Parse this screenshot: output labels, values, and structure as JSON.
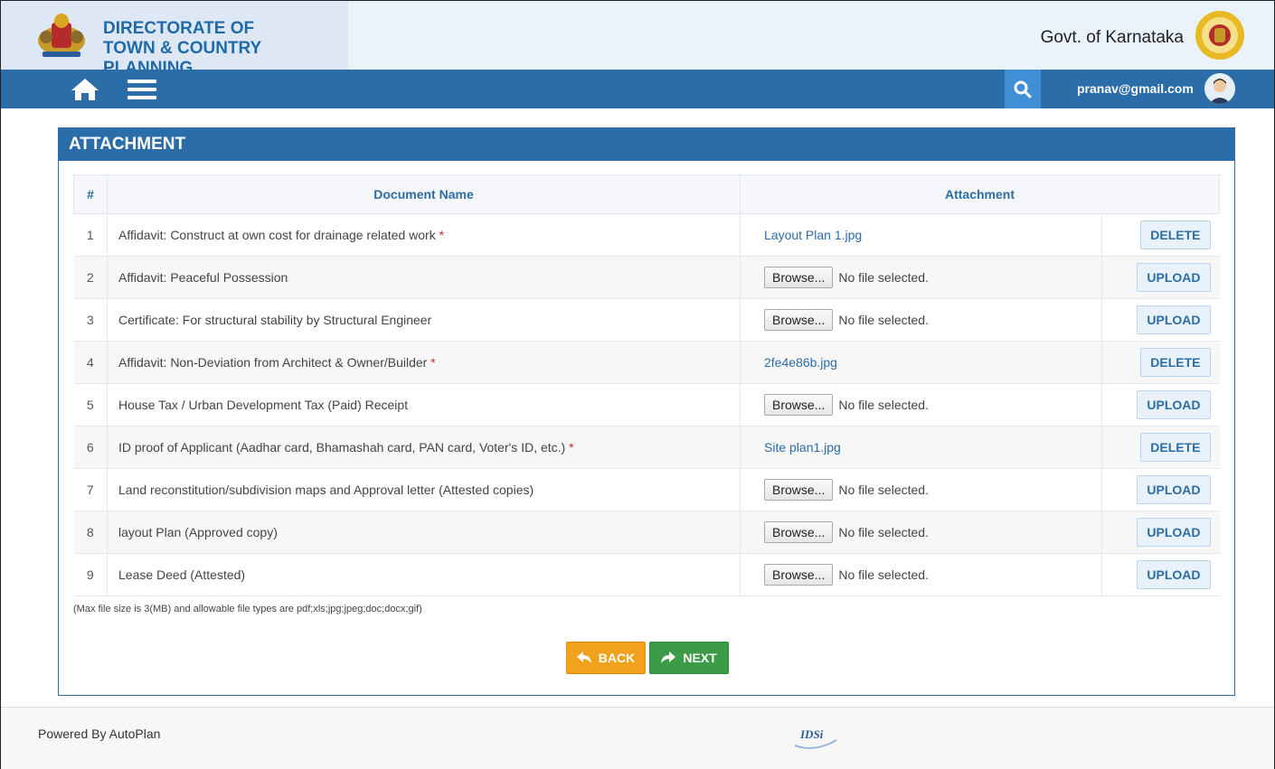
{
  "header": {
    "org_line1": "DIRECTORATE OF",
    "org_line2": "TOWN & COUNTRY PLANNING",
    "govt": "Govt. of Karnataka"
  },
  "navbar": {
    "user_email": "pranav@gmail.com"
  },
  "panel": {
    "title": "ATTACHMENT",
    "columns": [
      "#",
      "Document Name",
      "Attachment"
    ],
    "rows": [
      {
        "num": "1",
        "doc": "Affidavit: Construct at own cost for drainage related work",
        "required": true,
        "file": "Layout Plan 1.jpg",
        "action": "DELETE"
      },
      {
        "num": "2",
        "doc": "Affidavit: Peaceful Possession",
        "required": false,
        "file": null,
        "action": "UPLOAD"
      },
      {
        "num": "3",
        "doc": "Certificate: For structural stability by Structural Engineer",
        "required": false,
        "file": null,
        "action": "UPLOAD"
      },
      {
        "num": "4",
        "doc": "Affidavit: Non-Deviation from Architect & Owner/Builder",
        "required": true,
        "file": "2fe4e86b.jpg",
        "action": "DELETE"
      },
      {
        "num": "5",
        "doc": "House Tax / Urban Development Tax (Paid) Receipt",
        "required": false,
        "file": null,
        "action": "UPLOAD"
      },
      {
        "num": "6",
        "doc": "ID proof of Applicant (Aadhar card, Bhamashah card, PAN card, Voter's ID, etc.)",
        "required": true,
        "file": "Site plan1.jpg",
        "action": "DELETE"
      },
      {
        "num": "7",
        "doc": "Land reconstitution/subdivision maps and Approval letter (Attested copies)",
        "required": false,
        "file": null,
        "action": "UPLOAD"
      },
      {
        "num": "8",
        "doc": "layout Plan (Approved copy)",
        "required": false,
        "file": null,
        "action": "UPLOAD"
      },
      {
        "num": "9",
        "doc": "Lease Deed (Attested)",
        "required": false,
        "file": null,
        "action": "UPLOAD"
      }
    ],
    "browse_label": "Browse...",
    "no_file_text": "No file selected.",
    "required_mark": "*",
    "note": "(Max file size is 3(MB) and allowable file types are pdf;xls;jpg;jpeg;doc;docx;gif)",
    "back_label": "BACK",
    "next_label": "NEXT"
  },
  "footer": {
    "powered_by": "Powered By AutoPlan",
    "logo_text": "IDSi"
  },
  "colors": {
    "primary": "#2a6da8",
    "back": "#f0a21c",
    "next": "#3c9b47",
    "required": "#d9232d"
  }
}
